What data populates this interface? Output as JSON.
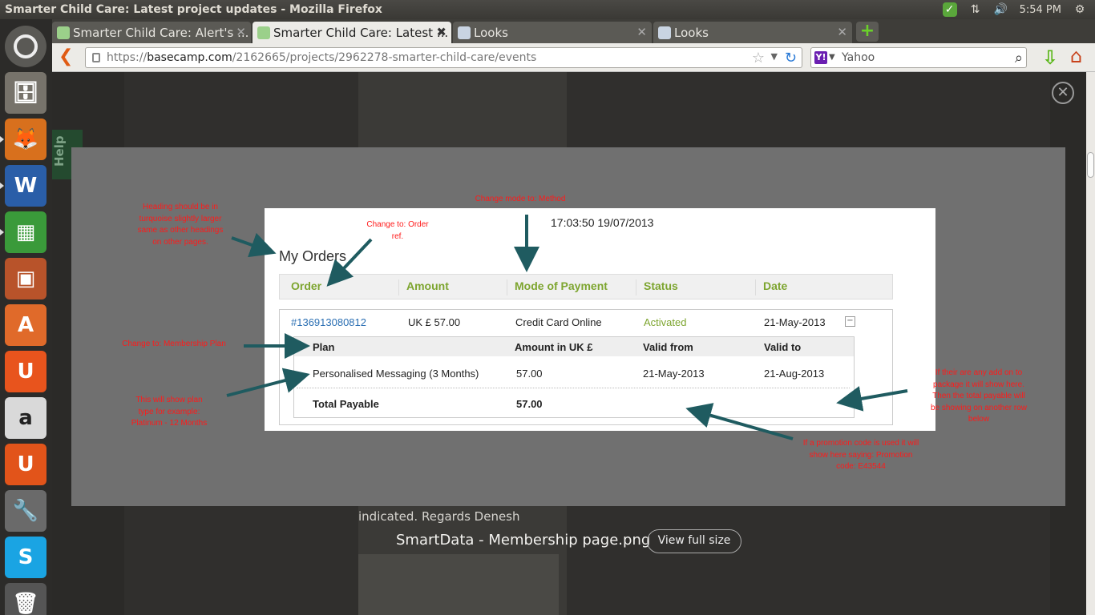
{
  "window": {
    "title": "Smarter Child Care: Latest project updates - Mozilla Firefox"
  },
  "tray": {
    "time": "5:54 PM"
  },
  "tabs": [
    {
      "label": "Smarter Child Care: Alert's ..."
    },
    {
      "label": "Smarter Child Care: Latest ..."
    },
    {
      "label": "Looks"
    },
    {
      "label": "Looks"
    }
  ],
  "nav": {
    "url_prefix": "https://",
    "url_domain": "basecamp.com",
    "url_path": "/2162665/projects/2962278-smarter-child-care/events",
    "search_engine": "Yahoo"
  },
  "page": {
    "help_label": "Help",
    "below_text": "indicated. Regards Denesh",
    "caption": "SmartData - Membership page.png",
    "view_full_label": "View full size"
  },
  "image": {
    "timestamp": "17:03:50 19/07/2013",
    "heading": "My Orders",
    "columns": [
      "Order",
      "Amount",
      "Mode of Payment",
      "Status",
      "Date"
    ],
    "order": {
      "id": "#136913080812",
      "amount": "UK £ 57.00",
      "mode": "Credit Card Online",
      "status": "Activated",
      "date": "21-May-2013"
    },
    "plan_columns": [
      "Plan",
      "Amount in UK £",
      "Valid from",
      "Valid to"
    ],
    "plan_row": {
      "plan": "Personalised Messaging (3 Months)",
      "amount": "57.00",
      "from": "21-May-2013",
      "to": "21-Aug-2013"
    },
    "total_label": "Total Payable",
    "total_value": "57.00",
    "notes": {
      "heading": "Heading should be in turquoise slightly larger same as other headings on other pages.",
      "order_ref": "Change to: Order ref.",
      "method": "Change mode to: Method",
      "membership": "Change to: Membership Plan",
      "plan_type": "This will show plan type for example: Platinum - 12 Months",
      "addon": "If their are any add on to package it will show here. Then the total payable will be showing on another row below",
      "promo": "If a promotion code is used it will show here saying: Promotion code: E43544"
    }
  },
  "colors": {
    "annotation": "#ff1a1a",
    "header_green": "#7da52f",
    "arrow": "#1f5b60",
    "link": "#2b6fb3"
  }
}
